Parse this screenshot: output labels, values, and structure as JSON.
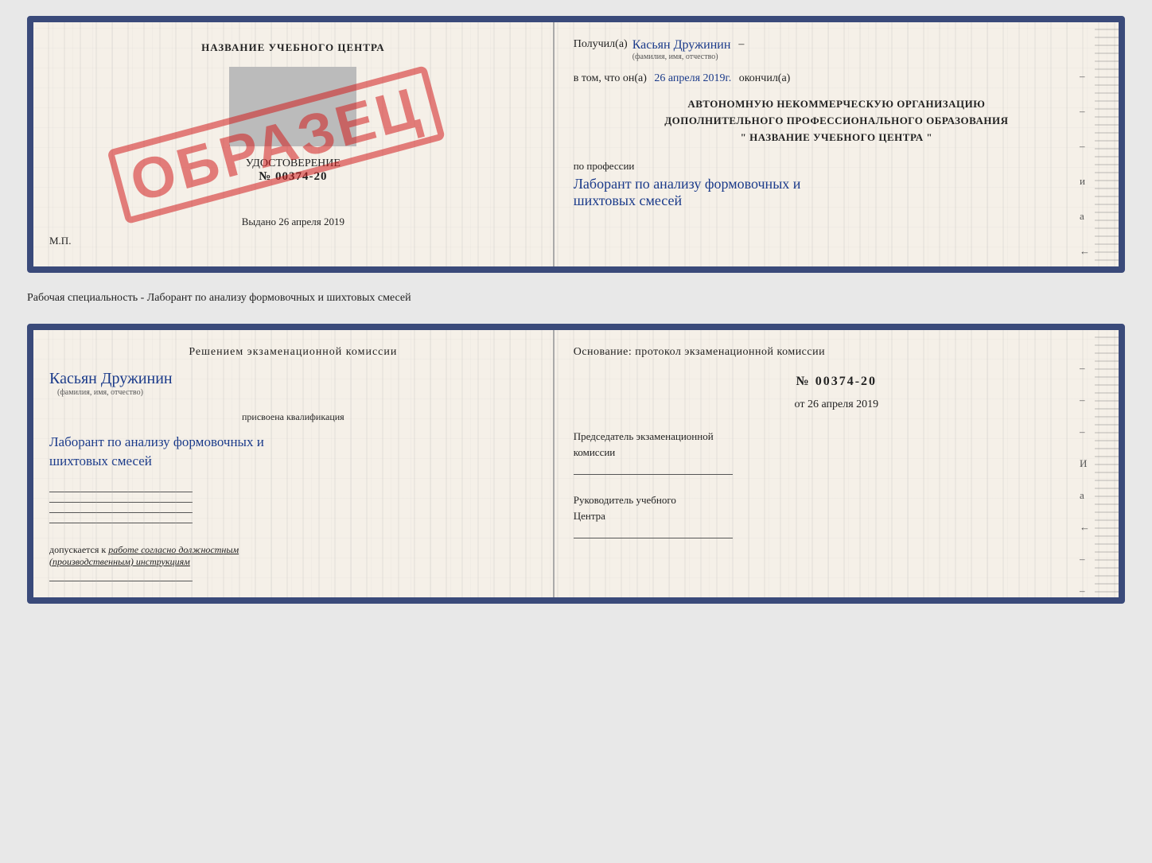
{
  "topDoc": {
    "left": {
      "header": "НАЗВАНИЕ УЧЕБНОГО ЦЕНТРА",
      "grayBox": true,
      "udostoverenie": "УДОСТОВЕРЕНИЕ",
      "number": "№ 00374-20",
      "stamp": "ОБРАЗЕЦ",
      "vydano": "Выдано",
      "vydanoDate": "26 апреля 2019",
      "mp": "М.П."
    },
    "right": {
      "poluchilLabel": "Получил(а)",
      "poluchilName": "Касьян Дружинин",
      "poluchilSubLabel": "(фамилия, имя, отчество)",
      "dash1": "–",
      "vtomLabel": "в том, что он(а)",
      "vtomDate": "26 апреля 2019г.",
      "okonchilLabel": "окончил(а)",
      "orgLine1": "АВТОНОМНУЮ НЕКОММЕРЧЕСКУЮ ОРГАНИЗАЦИЮ",
      "orgLine2": "ДОПОЛНИТЕЛЬНОГО ПРОФЕССИОНАЛЬНОГО ОБРАЗОВАНИЯ",
      "orgLine3": "\"  НАЗВАНИЕ УЧЕБНОГО ЦЕНТРА  \"",
      "dash2": "и",
      "dash3": "а",
      "dash4": "←",
      "poProf": "по профессии",
      "profHandwritten": "Лаборант по анализу формовочных и\nшихтовых смесей"
    }
  },
  "separator": {
    "text": "Рабочая специальность - Лаборант по анализу формовочных и шихтовых смесей"
  },
  "bottomDoc": {
    "left": {
      "resheniem": "Решением экзаменационной комиссии",
      "fio": "Касьян Дружинин",
      "fioSubLabel": "(фамилия, имя, отчество)",
      "prisvoena": "присвоена квалификация",
      "kvalifikaciya": "Лаборант по анализу формовочных и\nшихтовых смесей",
      "line1": "",
      "line2": "",
      "line3": "",
      "line4": "",
      "dopuskaetsya": "допускается к",
      "dopuskaetsyaItalic": "работе согласно должностным\n(производственным) инструкциям",
      "lineBottom": ""
    },
    "right": {
      "osnovanie": "Основание: протокол экзаменационной комиссии",
      "number": "№ 00374-20",
      "ot": "от",
      "otDate": "26 апреля 2019",
      "predsedatel1": "Председатель экзаменационной",
      "predsedatel2": "комиссии",
      "rukovoditel1": "Руководитель учебного",
      "rukovoditel2": "Центра",
      "sideMarkers": [
        "–",
        "–",
        "–",
        "И",
        "а",
        "←",
        "–",
        "–",
        "–"
      ]
    }
  }
}
